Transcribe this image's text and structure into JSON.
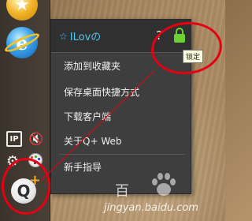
{
  "dock": {
    "apps": [
      {
        "icon": "star-app-icon"
      },
      {
        "icon": "ie-browser-icon",
        "glyph": "e"
      }
    ],
    "tools": [
      {
        "icon": "ip-icon",
        "glyph": "IP"
      },
      {
        "icon": "mute-speaker-icon",
        "glyph": "🔇"
      },
      {
        "icon": "gear-icon",
        "glyph": "⚙"
      },
      {
        "icon": "palette-icon"
      }
    ],
    "qplus": {
      "letter": "Q",
      "plus": "+"
    }
  },
  "menu": {
    "title_star": "☆",
    "title": "ILovの",
    "help_glyph": "?",
    "lock_color": "#6cd133",
    "items": [
      {
        "label": "添加到收藏夹"
      },
      {
        "label": "保存桌面快捷方式"
      },
      {
        "label": "下载客户端"
      },
      {
        "label": "关于Q+ Web"
      },
      {
        "label": "新手指导"
      }
    ]
  },
  "tooltip": {
    "text": "锁定"
  },
  "watermark": {
    "text": "jingyan.baidu.com",
    "glyph": "百"
  },
  "colors": {
    "annotation": "#e60012",
    "title_accent": "#4fc6ee"
  }
}
